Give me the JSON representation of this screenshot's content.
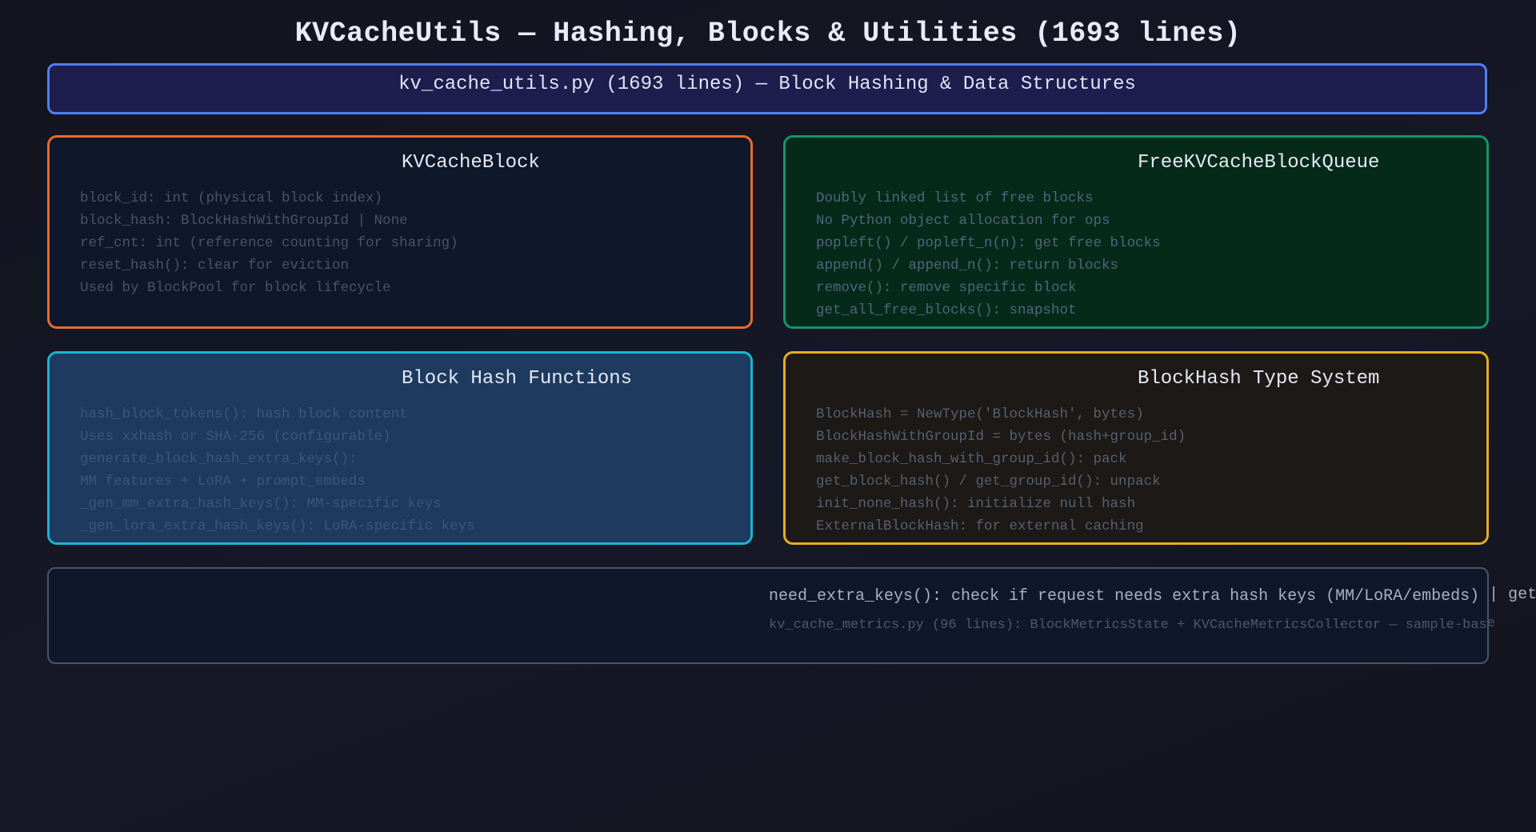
{
  "page": {
    "title": "KVCacheUtils — Hashing, Blocks & Utilities (1693 lines)"
  },
  "banner": {
    "text": "kv_cache_utils.py (1693 lines) — Block Hashing & Data Structures",
    "border_color": "#4f7ff0",
    "background": "#1f1d4d"
  },
  "cards": {
    "kvcacheblock": {
      "title": "KVCacheBlock",
      "border_color": "#e56c2c",
      "lines": [
        "block_id: int (physical block index)",
        "block_hash: BlockHashWithGroupId | None",
        "ref_cnt: int (reference counting for sharing)",
        "reset_hash(): clear for eviction",
        "Used by BlockPool for block lifecycle"
      ]
    },
    "free_queue": {
      "title": "FreeKVCacheBlockQueue",
      "border_color": "#13946b",
      "lines": [
        "Doubly linked list of free blocks",
        "No Python object allocation for ops",
        "popleft() / popleft_n(n): get free blocks",
        "append() / append_n(): return blocks",
        "remove(): remove specific block",
        "get_all_free_blocks(): snapshot"
      ]
    },
    "hash_functions": {
      "title": "Block Hash Functions",
      "border_color": "#19b4cf",
      "lines": [
        "hash_block_tokens(): hash block content",
        "Uses xxhash or SHA-256 (configurable)",
        "generate_block_hash_extra_keys():",
        "MM features + LoRA + prompt_embeds",
        "_gen_mm_extra_hash_keys(): MM-specific keys",
        "_gen_lora_extra_hash_keys(): LoRA-specific keys"
      ]
    },
    "type_system": {
      "title": "BlockHash Type System",
      "border_color": "#e7ad1f",
      "lines": [
        "BlockHash = NewType('BlockHash', bytes)",
        "BlockHashWithGroupId = bytes (hash+group_id)",
        "make_block_hash_with_group_id(): pack",
        "get_block_hash() / get_group_id(): unpack",
        "init_none_hash(): initialize null hash",
        "ExternalBlockHash: for external caching"
      ]
    }
  },
  "footer": {
    "line1": "need_extra_keys(): check if request needs extra hash keys (MM/LoRA/embeds) | get",
    "line2": "kv_cache_metrics.py (96 lines): BlockMetricsState + KVCacheMetricsCollector — sample-base"
  }
}
